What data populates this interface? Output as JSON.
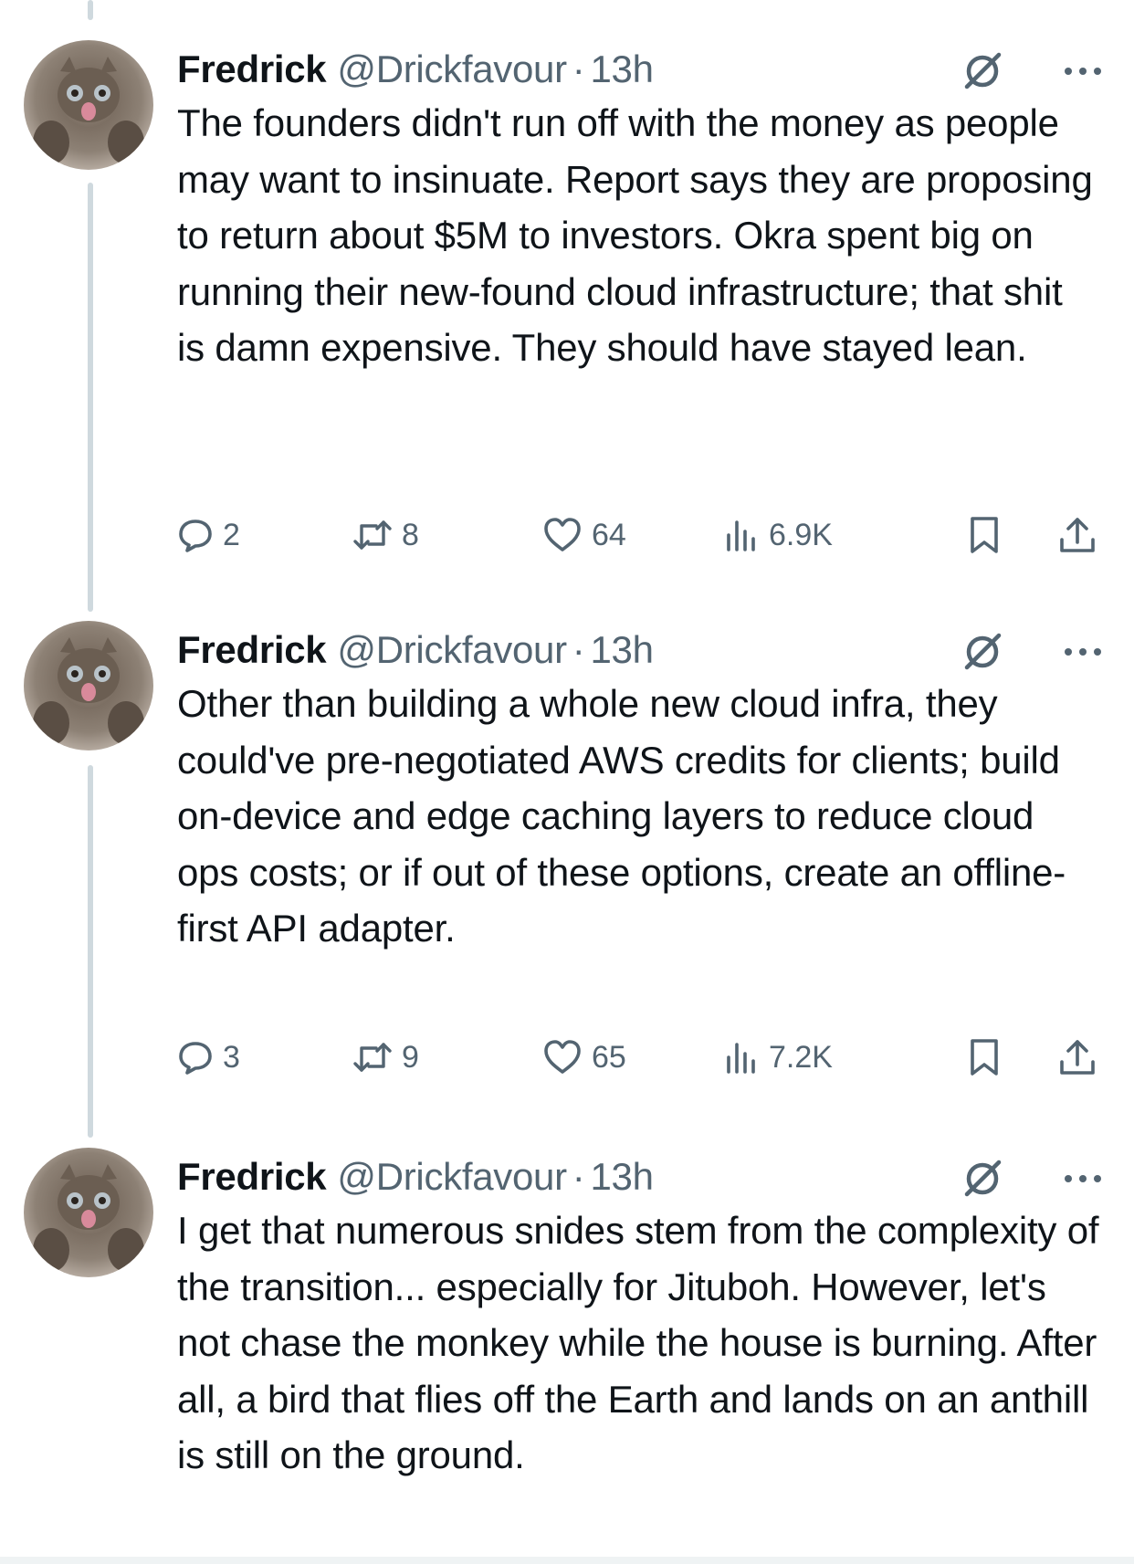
{
  "tweets": [
    {
      "author": {
        "display_name": "Fredrick",
        "handle": "@Drickfavour",
        "separator": "·",
        "time": "13h",
        "avatar_icon": "cat-avatar"
      },
      "text": "The founders didn't run off with the money as people may want to insinuate. Report says they are proposing to return about $5M to investors. Okra spent big on running their new-found cloud infrastructure; that shit is damn expensive. They should have stayed lean.",
      "stats": {
        "replies": "2",
        "reposts": "8",
        "likes": "64",
        "views": "6.9K"
      }
    },
    {
      "author": {
        "display_name": "Fredrick",
        "handle": "@Drickfavour",
        "separator": "·",
        "time": "13h",
        "avatar_icon": "cat-avatar"
      },
      "text": "Other than building a whole new cloud infra, they could've pre-negotiated AWS credits for clients; build on-device and edge caching layers to reduce cloud ops costs; or if out of these options, create an offline-first API adapter.",
      "stats": {
        "replies": "3",
        "reposts": "9",
        "likes": "65",
        "views": "7.2K"
      }
    },
    {
      "author": {
        "display_name": "Fredrick",
        "handle": "@Drickfavour",
        "separator": "·",
        "time": "13h",
        "avatar_icon": "cat-avatar"
      },
      "text": "I get that numerous snides stem from the complexity of the transition... especially for Jituboh. However, let's not chase the monkey while the house is burning. After all, a bird that flies off the Earth and lands on an anthill is still on the ground."
    }
  ],
  "icons": {
    "grok": "grok-icon",
    "more": "more-options-icon",
    "reply": "reply-icon",
    "repost": "repost-icon",
    "like": "heart-icon",
    "views": "views-icon",
    "bookmark": "bookmark-icon",
    "share": "share-icon"
  },
  "colors": {
    "text_primary": "#0f1419",
    "text_secondary": "#536471",
    "thread_line": "#cfd9de"
  }
}
